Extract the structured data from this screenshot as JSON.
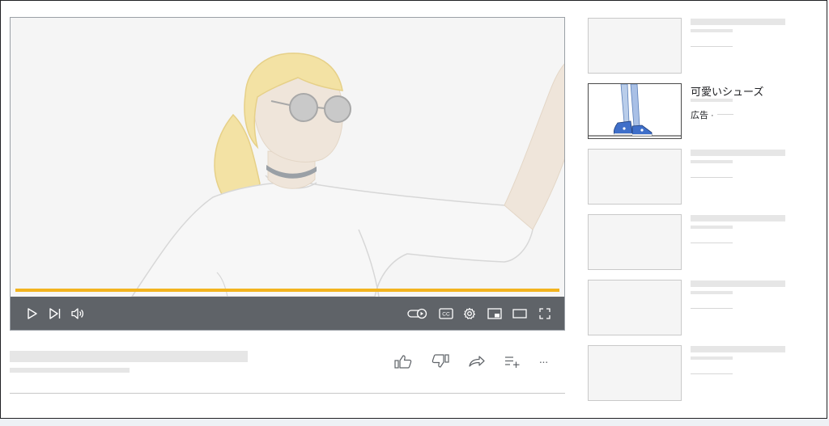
{
  "player": {
    "progress_fraction": 1.0,
    "accent_color": "#f2b41f",
    "controls_bg": "#5f6368",
    "left_controls": [
      "play-icon",
      "skip-next-icon",
      "volume-icon"
    ],
    "right_controls": [
      "autoplay-toggle-icon",
      "closed-captions-icon",
      "settings-gear-icon",
      "miniplayer-icon",
      "theater-mode-icon",
      "fullscreen-icon"
    ],
    "cc_text": "CC"
  },
  "actions": [
    "like-icon",
    "dislike-icon",
    "share-icon",
    "save-to-playlist-icon",
    "more-options-icon"
  ],
  "more_text": "···",
  "sidebar": {
    "ad": {
      "title": "可愛いシューズ",
      "label": "広告 ·"
    }
  }
}
